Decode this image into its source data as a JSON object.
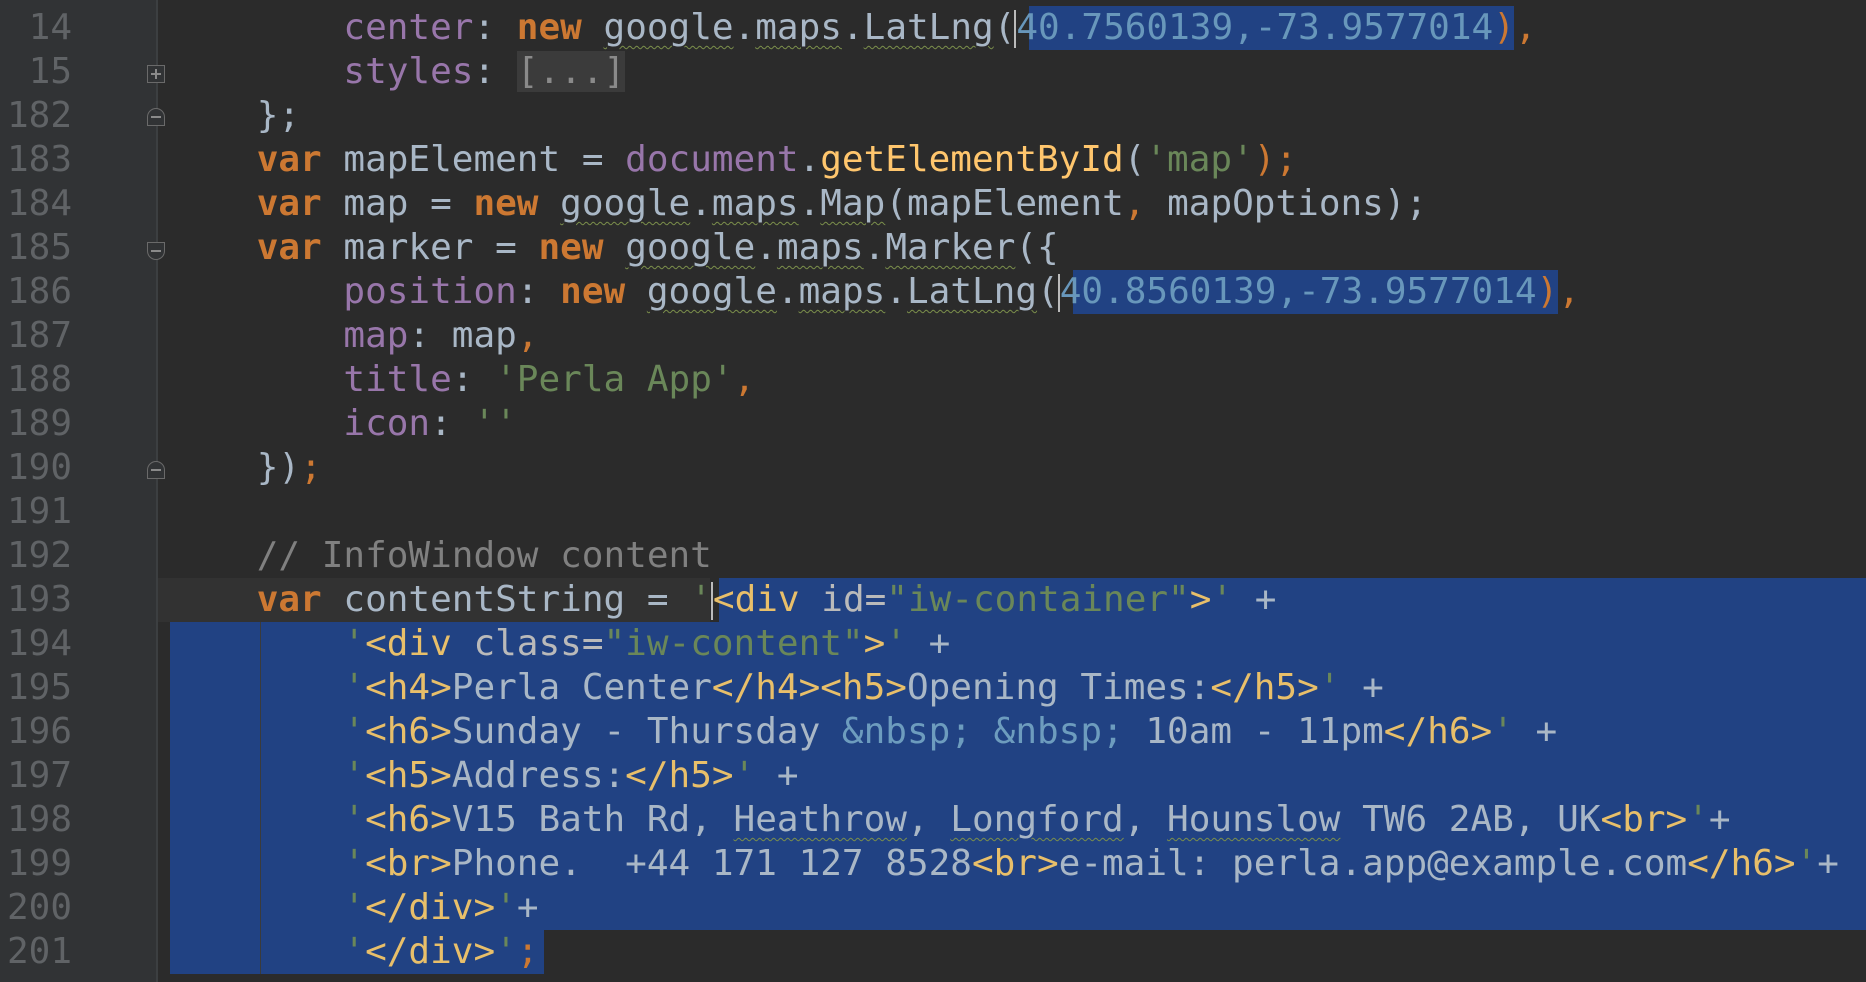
{
  "colors": {
    "background": "#2b2b2b",
    "gutter": "#313335",
    "selection": "#214283",
    "keyword": "#cc7832",
    "property": "#9876aa",
    "string": "#6a8759",
    "function": "#ffc66d",
    "comment": "#808080"
  },
  "line_numbers": [
    "14",
    "15",
    "182",
    "183",
    "184",
    "185",
    "186",
    "187",
    "188",
    "189",
    "190",
    "191",
    "192",
    "193",
    "194",
    "195",
    "196",
    "197",
    "198",
    "199",
    "200",
    "201"
  ],
  "code": {
    "l14": {
      "prop": "center",
      "colon": ": ",
      "kw": "new",
      "ns1": "google",
      "ns2": "maps",
      "cls": "LatLng",
      "coords": "40.7560139,-73.9577014",
      "tail": "),"
    },
    "l15": {
      "prop": "styles",
      "colon": ": ",
      "folded": "[...]"
    },
    "l182": {
      "text": "};"
    },
    "l183": {
      "kw": "var",
      "name": " mapElement = ",
      "obj": "document",
      "fn": "getElementById",
      "open": "(",
      "str": "'map'",
      "close": ");"
    },
    "l184": {
      "kw": "var",
      "name": " map = ",
      "kw2": "new",
      "ns1": "google",
      "ns2": "maps",
      "cls": "Map",
      "args": "(mapElement",
      "comma": ",",
      "args2": " mapOptions);"
    },
    "l185": {
      "kw": "var",
      "name": " marker = ",
      "kw2": "new",
      "ns1": "google",
      "ns2": "maps",
      "cls": "Marker",
      "tail": "({"
    },
    "l186": {
      "prop": "position",
      "colon": ": ",
      "kw": "new",
      "ns1": "google",
      "ns2": "maps",
      "cls": "LatLng",
      "coords": "40.8560139,-73.9577014",
      "tail": "),"
    },
    "l187": {
      "prop": "map",
      "colon": ": ",
      "val": "map",
      "comma": ","
    },
    "l188": {
      "prop": "title",
      "colon": ": ",
      "str": "'Perla App'",
      "comma": ","
    },
    "l189": {
      "prop": "icon",
      "colon": ": ",
      "str": "''"
    },
    "l190": {
      "text": "})",
      "semi": ";"
    },
    "l192": {
      "comment": "// InfoWindow content"
    },
    "l193": {
      "kw": "var",
      "name": " contentString = ",
      "q": "'",
      "t1": "<div",
      "a1": " id=",
      "v1": "\"iw-container\"",
      "t2": ">",
      "q2": "'",
      "plus": " +"
    },
    "l194": {
      "q": "'",
      "t1": "<div",
      "a1": " class=",
      "v1": "\"iw-content\"",
      "t2": ">",
      "q2": "'",
      "plus": " +"
    },
    "l195": {
      "q": "'",
      "t1": "<h4>",
      "txt1": "Perla Center",
      "t2": "</h4><h5>",
      "txt2": "Opening Times:",
      "t3": "</h5>",
      "q2": "'",
      "plus": " +"
    },
    "l196": {
      "q": "'",
      "t1": "<h6>",
      "txt1": "Sunday - Thursday ",
      "e1": "&nbsp;",
      "sp": " ",
      "e2": "&nbsp;",
      "txt2": " 10am - 11pm",
      "t2": "</h6>",
      "q2": "'",
      "plus": " +"
    },
    "l197": {
      "q": "'",
      "t1": "<h5>",
      "txt1": "Address:",
      "t2": "</h5>",
      "q2": "'",
      "plus": " +"
    },
    "l198": {
      "q": "'",
      "t1": "<h6>",
      "txt1": "V15 Bath Rd, ",
      "w1": "Heathrow",
      "c1": ", ",
      "w2": "Longford",
      "c2": ", ",
      "w3": "Hounslow",
      "txt2": " TW6 2AB, UK",
      "t2": "<br>",
      "q2": "'",
      "plus": "+"
    },
    "l199": {
      "q": "'",
      "t1": "<br>",
      "txt1": "Phone.  +44 171 127 8528",
      "t2": "<br>",
      "txt2": "e-mail: perla.app@example.com",
      "t3": "</h6>",
      "q2": "'",
      "plus": "+"
    },
    "l200": {
      "q": "'",
      "t1": "</div>",
      "q2": "'",
      "plus": "+"
    },
    "l201": {
      "q": "'",
      "t1": "</div>",
      "q2": "'",
      "semi": ";"
    }
  }
}
